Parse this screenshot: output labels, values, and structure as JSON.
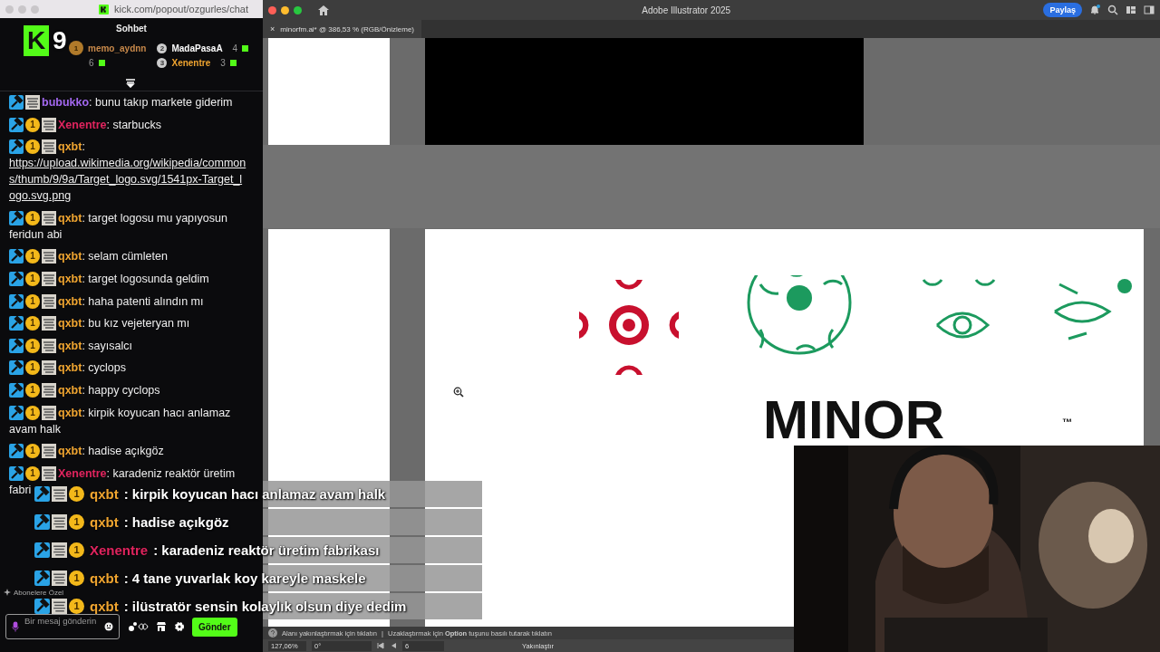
{
  "browser": {
    "url": "kick.com/popout/ozgurles/chat"
  },
  "stream_logo": {
    "letter": "K",
    "count": "9"
  },
  "chat": {
    "title": "Sohbet",
    "leaderboard": [
      {
        "rank": "1",
        "user": "memo_aydnn",
        "count": "6",
        "color": "#c8894a"
      },
      {
        "rank": "2",
        "user": "MadaPasaA",
        "count": "4",
        "color": "#ffffff"
      },
      {
        "rank": "3",
        "user": "Xenentre",
        "count": "3",
        "color": "#f0a530"
      }
    ],
    "messages": [
      {
        "badges": [
          {
            "kind": "mod"
          },
          {
            "kind": "gift"
          }
        ],
        "user": "bubukko",
        "color": "#a368f0",
        "text": ": bunu takıp markete giderim"
      },
      {
        "badges": [
          {
            "kind": "mod"
          },
          {
            "kind": "sub",
            "label": "1"
          },
          {
            "kind": "gift"
          }
        ],
        "user": "Xenentre",
        "color": "#e0245e",
        "text": ": starbucks"
      },
      {
        "badges": [
          {
            "kind": "mod"
          },
          {
            "kind": "sub",
            "label": "1"
          },
          {
            "kind": "gift"
          }
        ],
        "user": "qxbt",
        "color": "#f0a530",
        "text": ":",
        "link": "https://upload.wikimedia.org/wikipedia/commons/thumb/9/9a/Target_logo.svg/1541px-Target_logo.svg.png"
      },
      {
        "badges": [
          {
            "kind": "mod"
          },
          {
            "kind": "sub",
            "label": "1"
          },
          {
            "kind": "gift"
          }
        ],
        "user": "qxbt",
        "color": "#f0a530",
        "text": ": target logosu mu yapıyosun",
        "continuation": "feridun abi"
      },
      {
        "badges": [
          {
            "kind": "mod"
          },
          {
            "kind": "sub",
            "label": "1"
          },
          {
            "kind": "gift"
          }
        ],
        "user": "qxbt",
        "color": "#f0a530",
        "text": ": selam cümleten"
      },
      {
        "badges": [
          {
            "kind": "mod"
          },
          {
            "kind": "sub",
            "label": "1"
          },
          {
            "kind": "gift"
          }
        ],
        "user": "qxbt",
        "color": "#f0a530",
        "text": ": target logosunda geldim"
      },
      {
        "badges": [
          {
            "kind": "mod"
          },
          {
            "kind": "sub",
            "label": "1"
          },
          {
            "kind": "gift"
          }
        ],
        "user": "qxbt",
        "color": "#f0a530",
        "text": ": haha patenti alındın mı"
      },
      {
        "badges": [
          {
            "kind": "mod"
          },
          {
            "kind": "sub",
            "label": "1"
          },
          {
            "kind": "gift"
          }
        ],
        "user": "qxbt",
        "color": "#f0a530",
        "text": ": bu kız vejeteryan mı"
      },
      {
        "badges": [
          {
            "kind": "mod"
          },
          {
            "kind": "sub",
            "label": "1"
          },
          {
            "kind": "gift"
          }
        ],
        "user": "qxbt",
        "color": "#f0a530",
        "text": ": sayısalcı"
      },
      {
        "badges": [
          {
            "kind": "mod"
          },
          {
            "kind": "sub",
            "label": "1"
          },
          {
            "kind": "gift"
          }
        ],
        "user": "qxbt",
        "color": "#f0a530",
        "text": ": cyclops"
      },
      {
        "badges": [
          {
            "kind": "mod"
          },
          {
            "kind": "sub",
            "label": "1"
          },
          {
            "kind": "gift"
          }
        ],
        "user": "qxbt",
        "color": "#f0a530",
        "text": ": happy cyclops"
      },
      {
        "badges": [
          {
            "kind": "mod"
          },
          {
            "kind": "sub",
            "label": "1"
          },
          {
            "kind": "gift"
          }
        ],
        "user": "qxbt",
        "color": "#f0a530",
        "text": ": kirpik koyucan hacı anlamaz",
        "continuation": "avam halk"
      },
      {
        "badges": [
          {
            "kind": "mod"
          },
          {
            "kind": "sub",
            "label": "1"
          },
          {
            "kind": "gift"
          }
        ],
        "user": "qxbt",
        "color": "#f0a530",
        "text": ": hadise açıkgöz"
      },
      {
        "badges": [
          {
            "kind": "mod"
          },
          {
            "kind": "sub",
            "label": "1"
          },
          {
            "kind": "gift"
          }
        ],
        "user": "Xenentre",
        "color": "#e0245e",
        "text": ": karadeniz reaktör üretim",
        "continuation": "fabri"
      }
    ],
    "subscribers_label": "Abonelere Özel",
    "input": {
      "placeholder": "Bir mesaj gönderin"
    },
    "send_button": "Gönder"
  },
  "overlay_messages": [
    {
      "badges": [
        {
          "kind": "mod"
        },
        {
          "kind": "gift"
        },
        {
          "kind": "sub",
          "label": "1"
        }
      ],
      "user": "qxbt",
      "color": "#f0a530",
      "text": ": kirpik koyucan hacı anlamaz avam halk"
    },
    {
      "badges": [
        {
          "kind": "mod"
        },
        {
          "kind": "gift"
        },
        {
          "kind": "sub",
          "label": "1"
        }
      ],
      "user": "qxbt",
      "color": "#f0a530",
      "text": ": hadise açıkgöz"
    },
    {
      "badges": [
        {
          "kind": "mod"
        },
        {
          "kind": "gift"
        },
        {
          "kind": "sub",
          "label": "1"
        }
      ],
      "user": "Xenentre",
      "color": "#e0245e",
      "text": ": karadeniz reaktör üretim fabrikası"
    },
    {
      "badges": [
        {
          "kind": "mod"
        },
        {
          "kind": "gift"
        },
        {
          "kind": "sub",
          "label": "1"
        }
      ],
      "user": "qxbt",
      "color": "#f0a530",
      "text": ": 4 tane yuvarlak koy kareyle maskele"
    },
    {
      "badges": [
        {
          "kind": "mod"
        },
        {
          "kind": "gift"
        },
        {
          "kind": "sub",
          "label": "1"
        }
      ],
      "user": "qxbt",
      "color": "#f0a530",
      "text": ": ilüstratör sensin kolaylık olsun diye dedim"
    }
  ],
  "illustrator": {
    "title": "Adobe Illustrator 2025",
    "share_button": "Paylaş",
    "document_tab": {
      "label": "minorfm.ai* @ 386,53 % (RGB/Önizleme)",
      "close": "×"
    },
    "artwork": {
      "wordmark": "MINOR",
      "trademark": "™"
    },
    "hint": {
      "left": "Alanı yakınlaştırmak için tıklatın",
      "separator": "|",
      "right": "Uzaklaştırmak için **Option** tuşunu basılı tutarak tıklatın"
    },
    "status": {
      "zoom": "127,06%",
      "rotation": "0°",
      "artboard": "6",
      "tool": "Yakınlaştır"
    }
  }
}
